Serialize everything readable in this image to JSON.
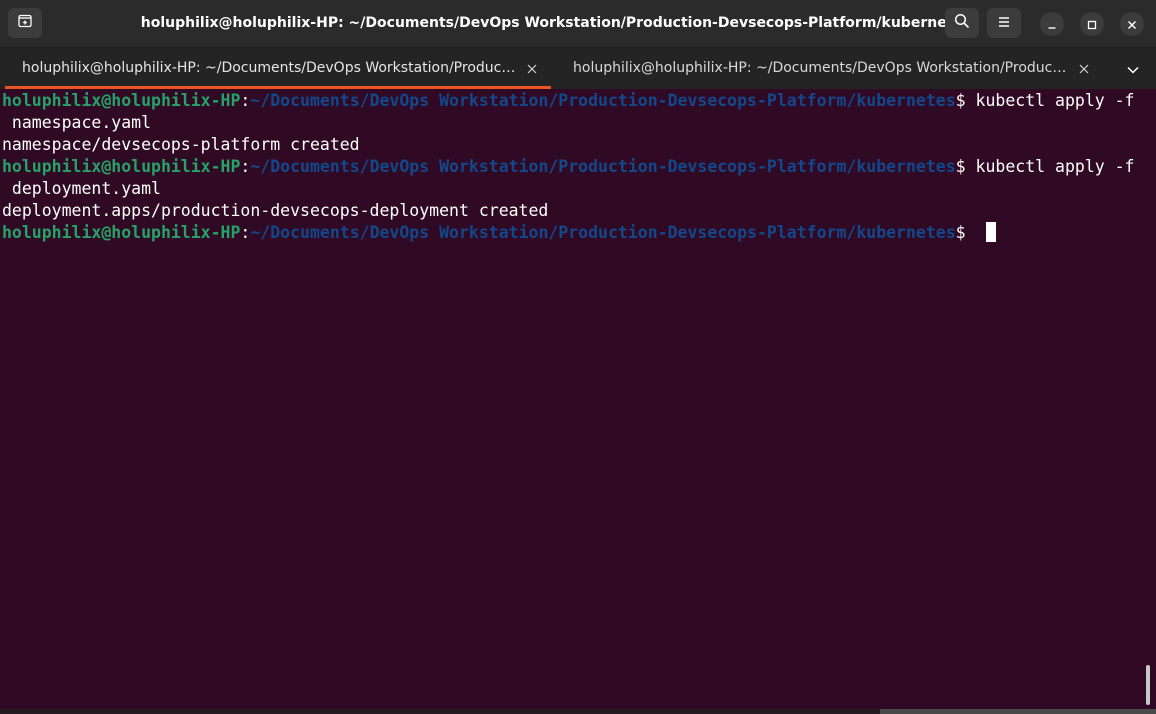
{
  "window": {
    "title": "holuphilix@holuphilix-HP: ~/Documents/DevOps Workstation/Production-Devsecops-Platform/kubernetes"
  },
  "headerbar": {
    "new_tab_icon": "new-tab-icon",
    "search_icon": "search-icon",
    "menu_icon": "hamburger-menu-icon",
    "minimize_icon": "minimize-icon",
    "maximize_icon": "maximize-icon",
    "close_icon": "close-icon"
  },
  "tabs": [
    {
      "label": "holuphilix@holuphilix-HP: ~/Documents/DevOps Workstation/Production-Devsecops-Platform/kubernetes",
      "active": true
    },
    {
      "label": "holuphilix@holuphilix-HP: ~/Documents/DevOps Workstation/Production-Devsecops-Platform/kubernetes",
      "active": false
    }
  ],
  "tab_overflow_icon": "chevron-down-icon",
  "prompt": {
    "user_host": "holuphilix@holuphilix-HP",
    "sep": ":",
    "path": "~/Documents/DevOps Workstation/Production-Devsecops-Platform/kubernetes",
    "dollar": "$ "
  },
  "terminal": {
    "cmd1": "kubectl apply -f",
    "cmd1_cont": " namespace.yaml",
    "out1": "namespace/devsecops-platform created",
    "cmd2": "kubectl apply -f",
    "cmd2_cont": " deployment.yaml",
    "out2": "deployment.apps/production-devsecops-deployment created"
  },
  "colors": {
    "background": "#300a24",
    "prompt_user": "#26a269",
    "prompt_path": "#12488b",
    "tab_indicator": "#e95420"
  }
}
